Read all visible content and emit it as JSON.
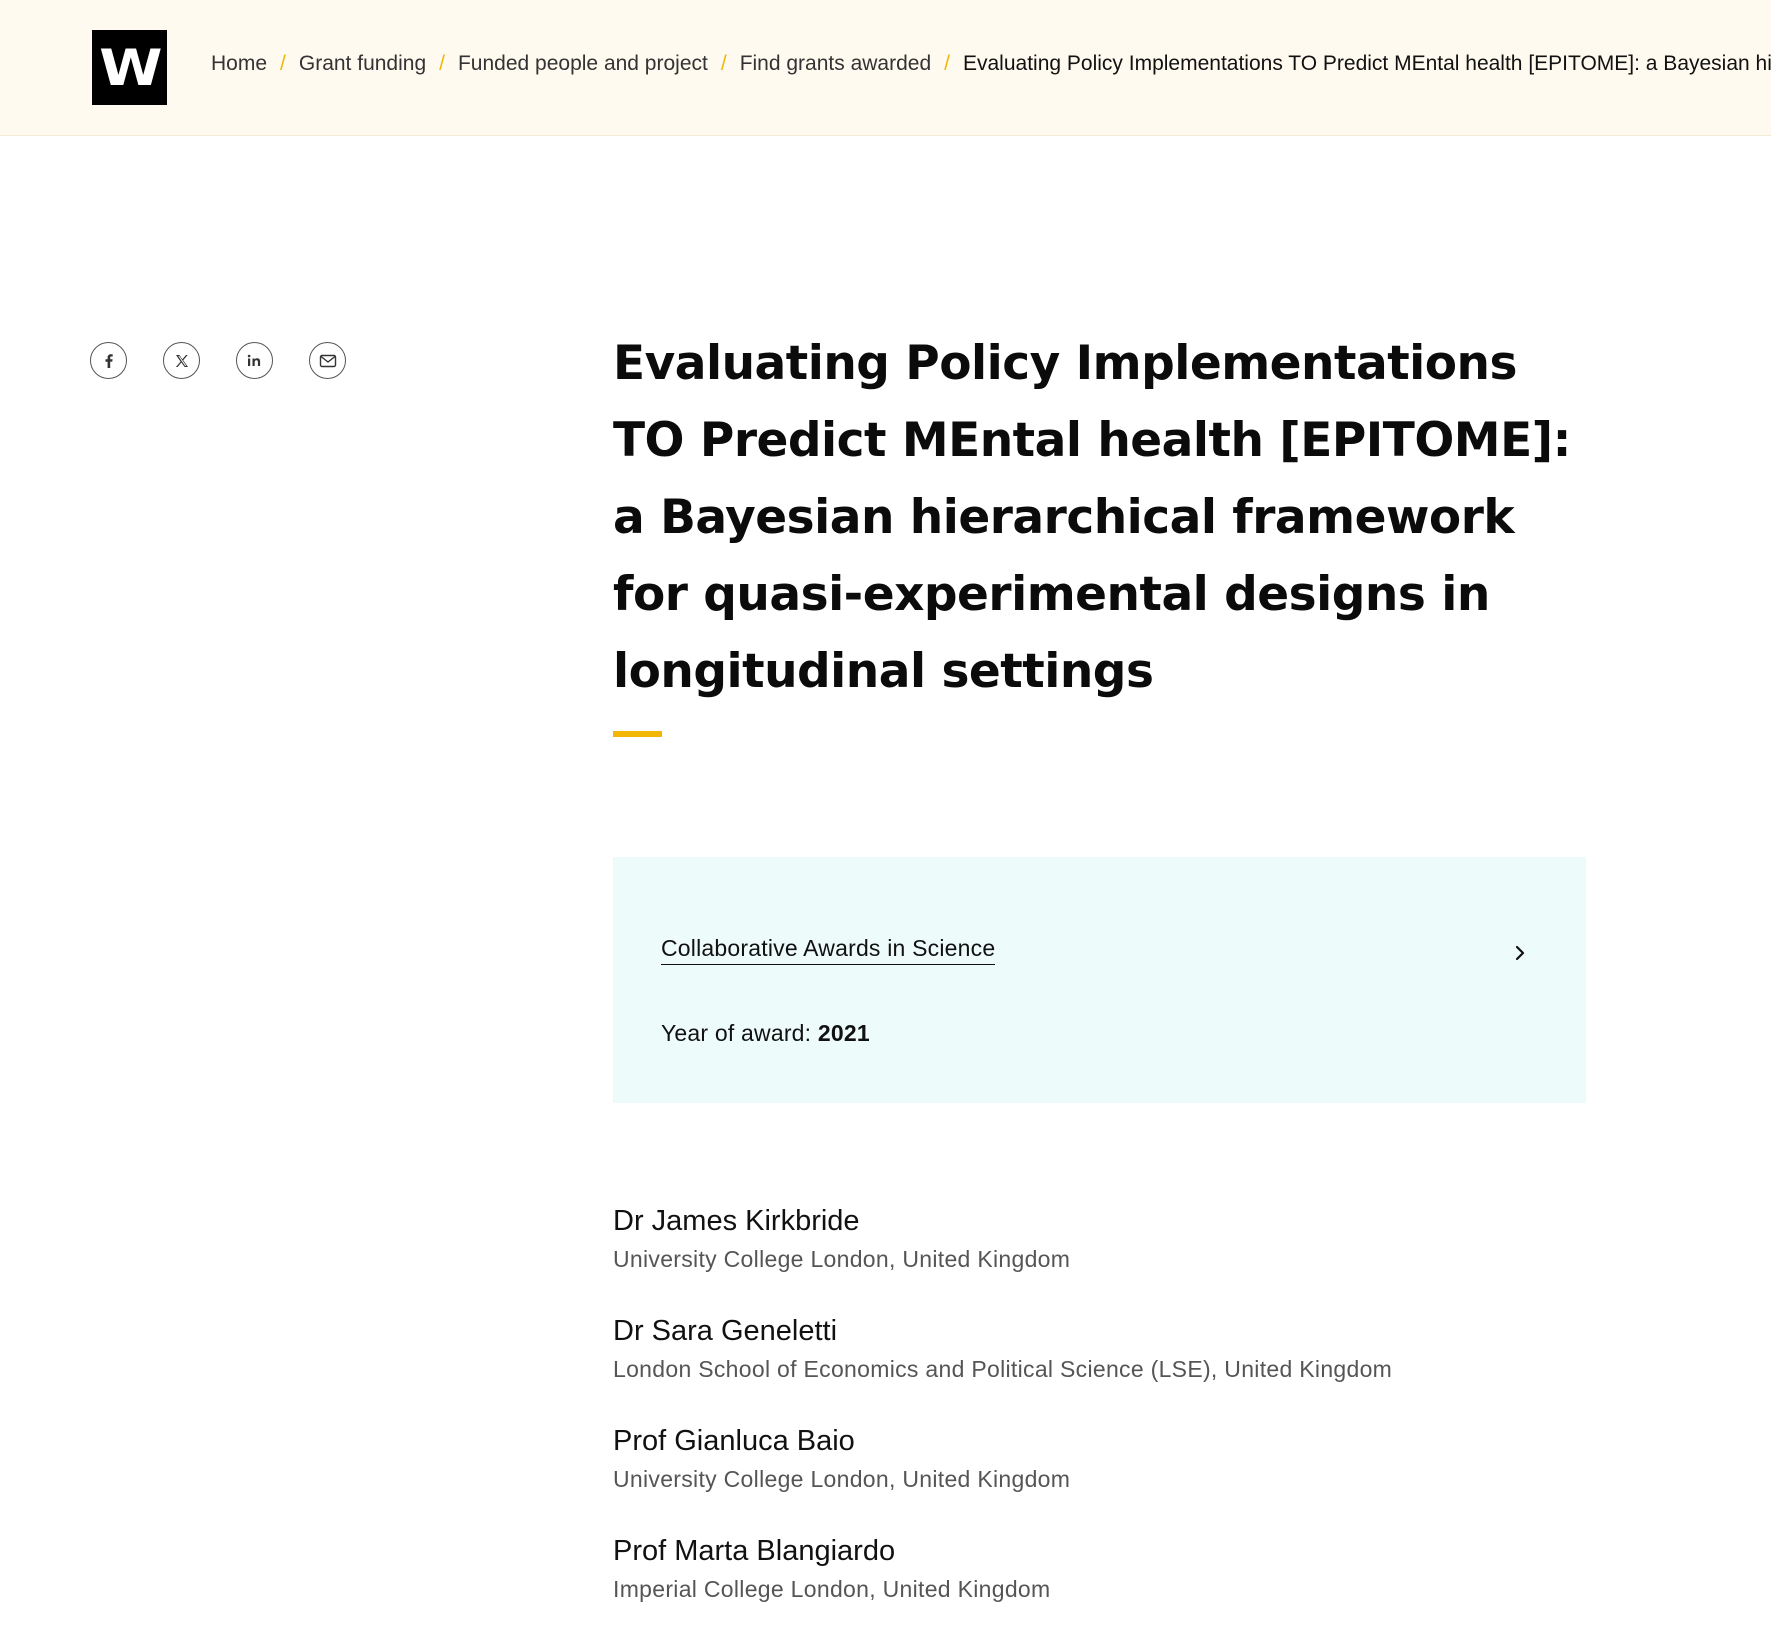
{
  "header": {
    "logo_text": "W",
    "breadcrumb": [
      {
        "label": "Home"
      },
      {
        "label": "Grant funding"
      },
      {
        "label": "Funded people and project"
      },
      {
        "label": "Find grants awarded"
      },
      {
        "label": "Evaluating Policy Implementations TO Predict MEntal health [EPITOME]: a Bayesian hierarchical framework for quasi-experimental designs in longitudinal settings"
      }
    ],
    "separator": "/"
  },
  "share": {
    "icons": [
      "facebook-icon",
      "x-icon",
      "linkedin-icon",
      "email-icon"
    ]
  },
  "main": {
    "title": "Evaluating Policy Implementations TO Predict MEntal health [EPITOME]: a Bayesian hierarchical framework for quasi-experimental designs in longitudinal settings"
  },
  "award": {
    "scheme": "Collaborative Awards in Science",
    "year_label": "Year of award:",
    "year": "2021"
  },
  "people": [
    {
      "name": "Dr James Kirkbride",
      "org": "University College London, United Kingdom"
    },
    {
      "name": "Dr Sara Geneletti",
      "org": "London School of Economics and Political Science (LSE), United Kingdom"
    },
    {
      "name": "Prof Gianluca Baio",
      "org": "University College London, United Kingdom"
    },
    {
      "name": "Prof Marta Blangiardo",
      "org": "Imperial College London, United Kingdom"
    }
  ],
  "colors": {
    "header_bg": "#fffaef",
    "accent": "#f2b705",
    "card_bg": "#eefbfb",
    "text": "#111111",
    "muted": "#555555"
  }
}
